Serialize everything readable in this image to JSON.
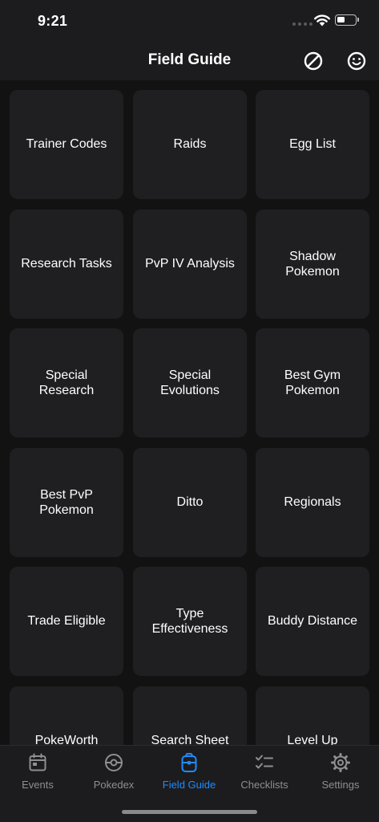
{
  "status_bar": {
    "time": "9:21"
  },
  "nav": {
    "title": "Field Guide"
  },
  "tiles": [
    "Trainer Codes",
    "Raids",
    "Egg List",
    "Research Tasks",
    "PvP IV Analysis",
    "Shadow\nPokemon",
    "Special\nResearch",
    "Special\nEvolutions",
    "Best Gym\nPokemon",
    "Best PvP\nPokemon",
    "Ditto",
    "Regionals",
    "Trade Eligible",
    "Type\nEffectiveness",
    "Buddy Distance",
    "PokeWorth",
    "Search Sheet",
    "Level Up"
  ],
  "tab_bar": {
    "tabs": [
      {
        "label": "Events",
        "icon": "calendar-icon",
        "active": false
      },
      {
        "label": "Pokedex",
        "icon": "pokeball-icon",
        "active": false
      },
      {
        "label": "Field Guide",
        "icon": "backpack-icon",
        "active": true
      },
      {
        "label": "Checklists",
        "icon": "checklist-icon",
        "active": false
      },
      {
        "label": "Settings",
        "icon": "gear-icon",
        "active": false
      }
    ]
  },
  "colors": {
    "accent": "#1e8cff",
    "tile_bg": "#1f1f21",
    "bar_bg": "#1c1c1e",
    "inactive": "#8e8e93"
  }
}
